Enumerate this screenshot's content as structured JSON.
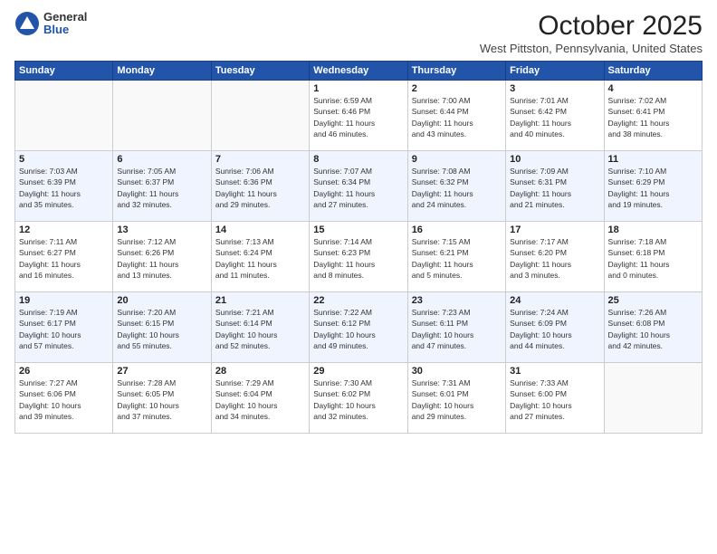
{
  "header": {
    "logo_general": "General",
    "logo_blue": "Blue",
    "title": "October 2025",
    "location": "West Pittston, Pennsylvania, United States"
  },
  "days_of_week": [
    "Sunday",
    "Monday",
    "Tuesday",
    "Wednesday",
    "Thursday",
    "Friday",
    "Saturday"
  ],
  "weeks": [
    [
      {
        "day": "",
        "info": ""
      },
      {
        "day": "",
        "info": ""
      },
      {
        "day": "",
        "info": ""
      },
      {
        "day": "1",
        "info": "Sunrise: 6:59 AM\nSunset: 6:46 PM\nDaylight: 11 hours\nand 46 minutes."
      },
      {
        "day": "2",
        "info": "Sunrise: 7:00 AM\nSunset: 6:44 PM\nDaylight: 11 hours\nand 43 minutes."
      },
      {
        "day": "3",
        "info": "Sunrise: 7:01 AM\nSunset: 6:42 PM\nDaylight: 11 hours\nand 40 minutes."
      },
      {
        "day": "4",
        "info": "Sunrise: 7:02 AM\nSunset: 6:41 PM\nDaylight: 11 hours\nand 38 minutes."
      }
    ],
    [
      {
        "day": "5",
        "info": "Sunrise: 7:03 AM\nSunset: 6:39 PM\nDaylight: 11 hours\nand 35 minutes."
      },
      {
        "day": "6",
        "info": "Sunrise: 7:05 AM\nSunset: 6:37 PM\nDaylight: 11 hours\nand 32 minutes."
      },
      {
        "day": "7",
        "info": "Sunrise: 7:06 AM\nSunset: 6:36 PM\nDaylight: 11 hours\nand 29 minutes."
      },
      {
        "day": "8",
        "info": "Sunrise: 7:07 AM\nSunset: 6:34 PM\nDaylight: 11 hours\nand 27 minutes."
      },
      {
        "day": "9",
        "info": "Sunrise: 7:08 AM\nSunset: 6:32 PM\nDaylight: 11 hours\nand 24 minutes."
      },
      {
        "day": "10",
        "info": "Sunrise: 7:09 AM\nSunset: 6:31 PM\nDaylight: 11 hours\nand 21 minutes."
      },
      {
        "day": "11",
        "info": "Sunrise: 7:10 AM\nSunset: 6:29 PM\nDaylight: 11 hours\nand 19 minutes."
      }
    ],
    [
      {
        "day": "12",
        "info": "Sunrise: 7:11 AM\nSunset: 6:27 PM\nDaylight: 11 hours\nand 16 minutes."
      },
      {
        "day": "13",
        "info": "Sunrise: 7:12 AM\nSunset: 6:26 PM\nDaylight: 11 hours\nand 13 minutes."
      },
      {
        "day": "14",
        "info": "Sunrise: 7:13 AM\nSunset: 6:24 PM\nDaylight: 11 hours\nand 11 minutes."
      },
      {
        "day": "15",
        "info": "Sunrise: 7:14 AM\nSunset: 6:23 PM\nDaylight: 11 hours\nand 8 minutes."
      },
      {
        "day": "16",
        "info": "Sunrise: 7:15 AM\nSunset: 6:21 PM\nDaylight: 11 hours\nand 5 minutes."
      },
      {
        "day": "17",
        "info": "Sunrise: 7:17 AM\nSunset: 6:20 PM\nDaylight: 11 hours\nand 3 minutes."
      },
      {
        "day": "18",
        "info": "Sunrise: 7:18 AM\nSunset: 6:18 PM\nDaylight: 11 hours\nand 0 minutes."
      }
    ],
    [
      {
        "day": "19",
        "info": "Sunrise: 7:19 AM\nSunset: 6:17 PM\nDaylight: 10 hours\nand 57 minutes."
      },
      {
        "day": "20",
        "info": "Sunrise: 7:20 AM\nSunset: 6:15 PM\nDaylight: 10 hours\nand 55 minutes."
      },
      {
        "day": "21",
        "info": "Sunrise: 7:21 AM\nSunset: 6:14 PM\nDaylight: 10 hours\nand 52 minutes."
      },
      {
        "day": "22",
        "info": "Sunrise: 7:22 AM\nSunset: 6:12 PM\nDaylight: 10 hours\nand 49 minutes."
      },
      {
        "day": "23",
        "info": "Sunrise: 7:23 AM\nSunset: 6:11 PM\nDaylight: 10 hours\nand 47 minutes."
      },
      {
        "day": "24",
        "info": "Sunrise: 7:24 AM\nSunset: 6:09 PM\nDaylight: 10 hours\nand 44 minutes."
      },
      {
        "day": "25",
        "info": "Sunrise: 7:26 AM\nSunset: 6:08 PM\nDaylight: 10 hours\nand 42 minutes."
      }
    ],
    [
      {
        "day": "26",
        "info": "Sunrise: 7:27 AM\nSunset: 6:06 PM\nDaylight: 10 hours\nand 39 minutes."
      },
      {
        "day": "27",
        "info": "Sunrise: 7:28 AM\nSunset: 6:05 PM\nDaylight: 10 hours\nand 37 minutes."
      },
      {
        "day": "28",
        "info": "Sunrise: 7:29 AM\nSunset: 6:04 PM\nDaylight: 10 hours\nand 34 minutes."
      },
      {
        "day": "29",
        "info": "Sunrise: 7:30 AM\nSunset: 6:02 PM\nDaylight: 10 hours\nand 32 minutes."
      },
      {
        "day": "30",
        "info": "Sunrise: 7:31 AM\nSunset: 6:01 PM\nDaylight: 10 hours\nand 29 minutes."
      },
      {
        "day": "31",
        "info": "Sunrise: 7:33 AM\nSunset: 6:00 PM\nDaylight: 10 hours\nand 27 minutes."
      },
      {
        "day": "",
        "info": ""
      }
    ]
  ]
}
